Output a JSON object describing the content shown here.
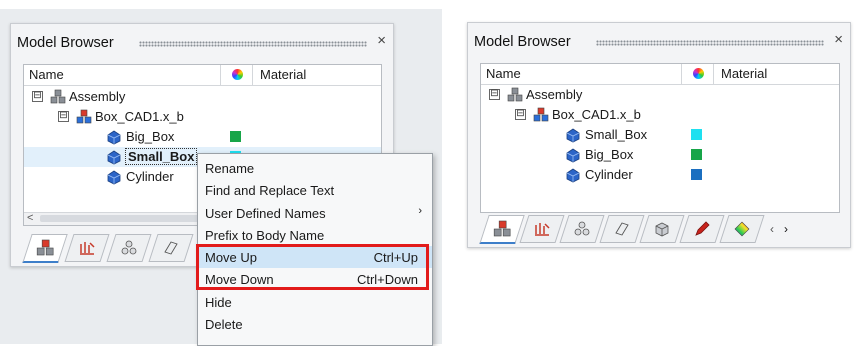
{
  "left_panel": {
    "title": "Model Browser",
    "close_glyph": "×",
    "columns": {
      "name": "Name",
      "material": "Material"
    },
    "tree": [
      {
        "label": "Assembly",
        "level": 0,
        "expander": "⊟",
        "icon": "assembly-icon"
      },
      {
        "label": "Box_CAD1.x_b",
        "level": 1,
        "expander": "⊟",
        "icon": "component-icon"
      },
      {
        "label": "Big_Box",
        "level": 2,
        "icon": "part-icon",
        "color": "#17a548"
      },
      {
        "label": "Small_Box",
        "level": 2,
        "icon": "part-icon",
        "color": "#1ee0f0",
        "selected": true
      },
      {
        "label": "Cylinder",
        "level": 2,
        "icon": "part-icon"
      }
    ],
    "scroll_left": "<",
    "tab_icons": [
      "model-tab-icon",
      "connector-tab-icon",
      "assembly-tab-icon",
      "face-tab-icon"
    ]
  },
  "context_menu": {
    "items": [
      {
        "label": "Rename"
      },
      {
        "label": "Find and Replace Text"
      },
      {
        "label": "User Defined Names",
        "submenu_arrow": "›"
      },
      {
        "label": "Prefix to Body Name"
      },
      {
        "label": "Move Up",
        "shortcut": "Ctrl+Up",
        "highlighted": true
      },
      {
        "label": "Move Down",
        "shortcut": "Ctrl+Down"
      },
      {
        "label": "Hide"
      },
      {
        "label": "Delete"
      }
    ]
  },
  "right_panel": {
    "title": "Model Browser",
    "close_glyph": "×",
    "columns": {
      "name": "Name",
      "material": "Material"
    },
    "tree": [
      {
        "label": "Assembly",
        "level": 0,
        "expander": "⊟",
        "icon": "assembly-icon"
      },
      {
        "label": "Box_CAD1.x_b",
        "level": 1,
        "expander": "⊟",
        "icon": "component-icon"
      },
      {
        "label": "Small_Box",
        "level": 2,
        "icon": "part-icon",
        "color": "#1ee0f0"
      },
      {
        "label": "Big_Box",
        "level": 2,
        "icon": "part-icon",
        "color": "#17a548"
      },
      {
        "label": "Cylinder",
        "level": 2,
        "icon": "part-icon",
        "color": "#1b6fc0"
      }
    ],
    "tab_icons": [
      "model-tab-icon",
      "connector-tab-icon",
      "assembly-tab-icon",
      "face-tab-icon",
      "box-tab-icon",
      "pen-tab-icon",
      "contour-tab-icon"
    ],
    "tab_nav": {
      "prev": "‹",
      "next": "›"
    }
  }
}
